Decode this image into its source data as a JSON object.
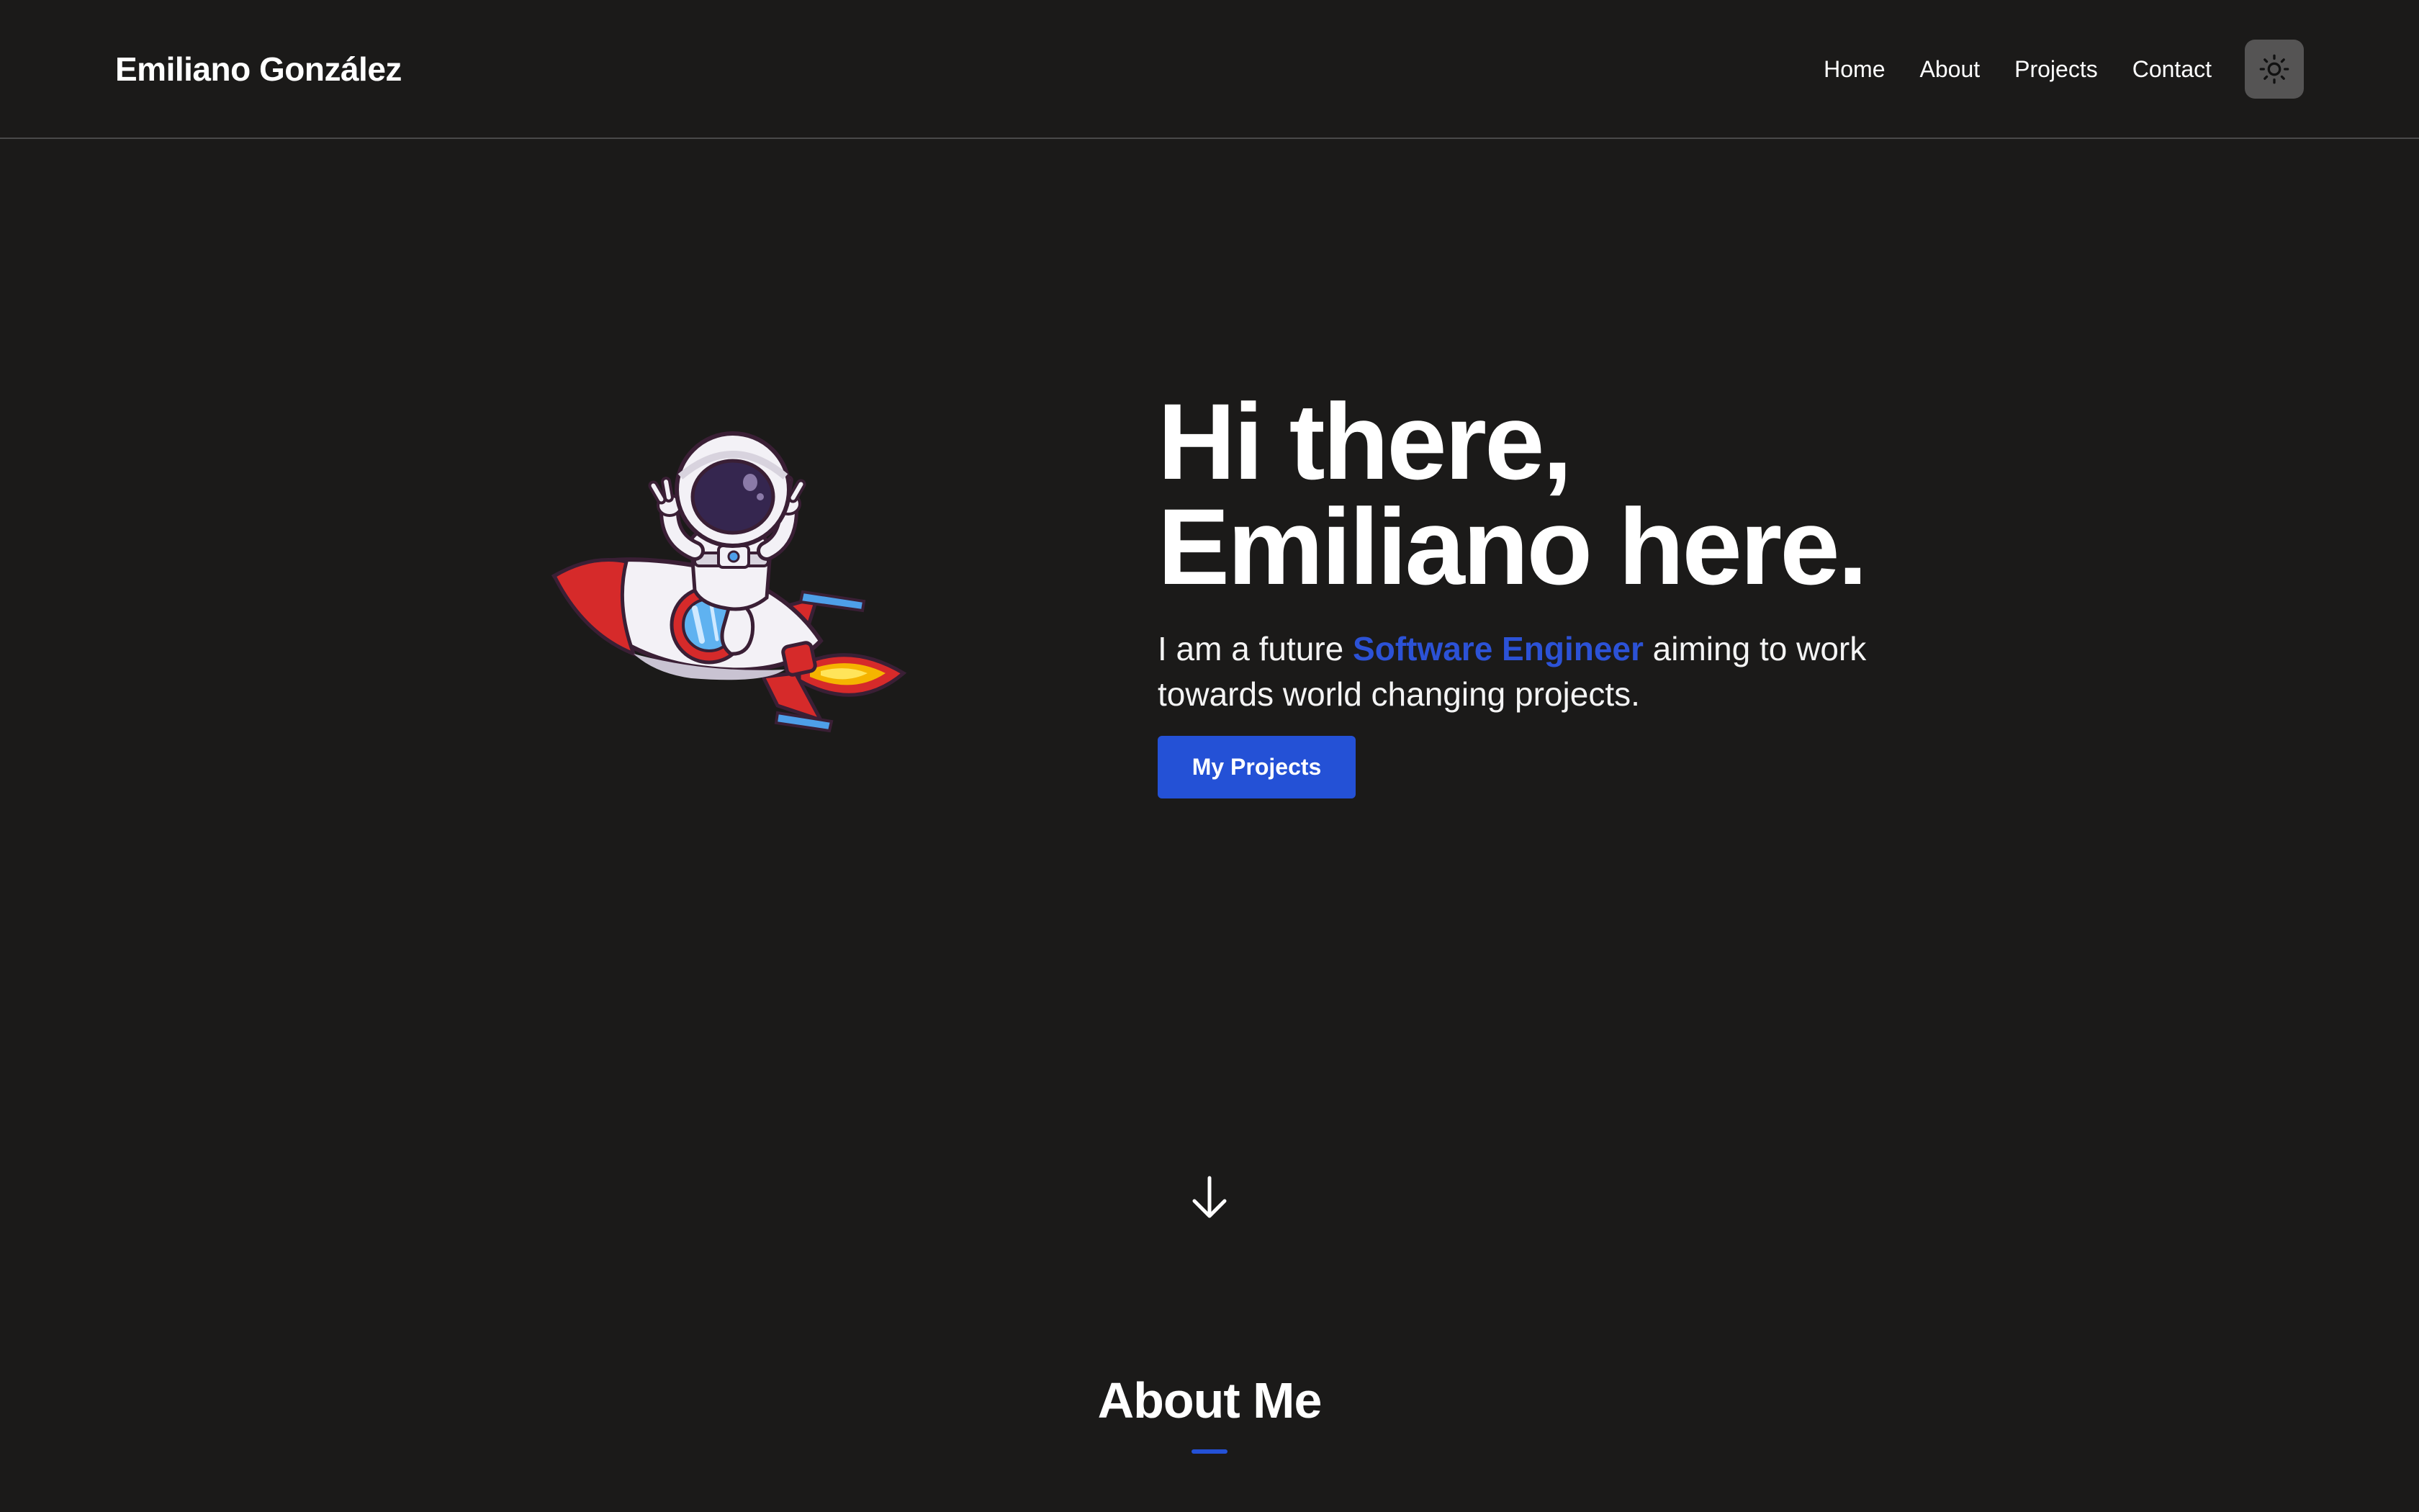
{
  "header": {
    "brand": "Emiliano González",
    "nav": {
      "home": "Home",
      "about": "About",
      "projects": "Projects",
      "contact": "Contact"
    },
    "theme_toggle_icon": "sun-icon"
  },
  "hero": {
    "title_line1": "Hi there,",
    "title_line2": "Emiliano here.",
    "sub_prefix": "I am a future ",
    "sub_accent": "Software Engineer",
    "sub_suffix": " aiming to work towards world changing projects.",
    "cta_label": "My Projects",
    "illustration_icon": "astronaut-rocket-illustration"
  },
  "scroll_icon": "arrow-down-icon",
  "about": {
    "title": "About Me"
  },
  "colors": {
    "background": "#1b1a19",
    "accent": "#2451d6",
    "text": "#ffffff",
    "toggle_bg": "#555454"
  }
}
